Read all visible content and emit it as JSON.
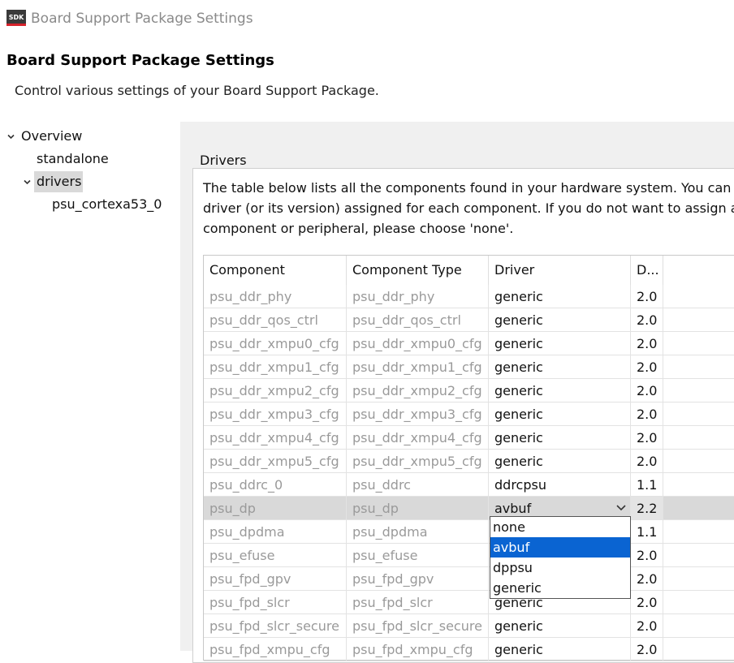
{
  "window": {
    "logo_text": "SDK",
    "title": "Board Support Package Settings"
  },
  "header": {
    "title": "Board Support Package Settings",
    "description": "Control various settings of your Board Support Package."
  },
  "tree": {
    "items": [
      {
        "label": "Overview",
        "expanded": true
      },
      {
        "label": "standalone"
      },
      {
        "label": "drivers",
        "expanded": true,
        "selected": true
      },
      {
        "label": "psu_cortexa53_0"
      }
    ]
  },
  "drivers": {
    "group_label": "Drivers",
    "description": [
      "The table below lists all the components found in your hardware system. You can m",
      "driver (or its version) assigned for each component. If you do not want to assign a",
      "component or peripheral, please choose 'none'."
    ],
    "columns": [
      "Component",
      "Component Type",
      "Driver",
      "D..."
    ],
    "rows": [
      {
        "component": "psu_ddr_phy",
        "type": "psu_ddr_phy",
        "driver": "generic",
        "version": "2.0"
      },
      {
        "component": "psu_ddr_qos_ctrl",
        "type": "psu_ddr_qos_ctrl",
        "driver": "generic",
        "version": "2.0"
      },
      {
        "component": "psu_ddr_xmpu0_cfg",
        "type": "psu_ddr_xmpu0_cfg",
        "driver": "generic",
        "version": "2.0"
      },
      {
        "component": "psu_ddr_xmpu1_cfg",
        "type": "psu_ddr_xmpu1_cfg",
        "driver": "generic",
        "version": "2.0"
      },
      {
        "component": "psu_ddr_xmpu2_cfg",
        "type": "psu_ddr_xmpu2_cfg",
        "driver": "generic",
        "version": "2.0"
      },
      {
        "component": "psu_ddr_xmpu3_cfg",
        "type": "psu_ddr_xmpu3_cfg",
        "driver": "generic",
        "version": "2.0"
      },
      {
        "component": "psu_ddr_xmpu4_cfg",
        "type": "psu_ddr_xmpu4_cfg",
        "driver": "generic",
        "version": "2.0"
      },
      {
        "component": "psu_ddr_xmpu5_cfg",
        "type": "psu_ddr_xmpu5_cfg",
        "driver": "generic",
        "version": "2.0"
      },
      {
        "component": "psu_ddrc_0",
        "type": "psu_ddrc",
        "driver": "ddrcpsu",
        "version": "1.1"
      },
      {
        "component": "psu_dp",
        "type": "psu_dp",
        "driver": "avbuf",
        "version": "2.2",
        "selected": true
      },
      {
        "component": "psu_dpdma",
        "type": "psu_dpdma",
        "driver": "",
        "version": "1.1"
      },
      {
        "component": "psu_efuse",
        "type": "psu_efuse",
        "driver": "",
        "version": "2.0"
      },
      {
        "component": "psu_fpd_gpv",
        "type": "psu_fpd_gpv",
        "driver": "",
        "version": "2.0"
      },
      {
        "component": "psu_fpd_slcr",
        "type": "psu_fpd_slcr",
        "driver": "generic",
        "version": "2.0"
      },
      {
        "component": "psu_fpd_slcr_secure",
        "type": "psu_fpd_slcr_secure",
        "driver": "generic",
        "version": "2.0"
      },
      {
        "component": "psu_fpd_xmpu_cfg",
        "type": "psu_fpd_xmpu_cfg",
        "driver": "generic",
        "version": "2.0"
      }
    ],
    "dropdown": {
      "options": [
        "none",
        "avbuf",
        "dppsu",
        "generic"
      ],
      "selected": "avbuf"
    }
  },
  "colors": {
    "selection": "#0a64d2",
    "row_selected": "#d9d9d9",
    "disabled_text": "#9a9a9a"
  },
  "icons": {
    "expand": "chevron-down-icon",
    "combo": "chevron-down-icon"
  }
}
